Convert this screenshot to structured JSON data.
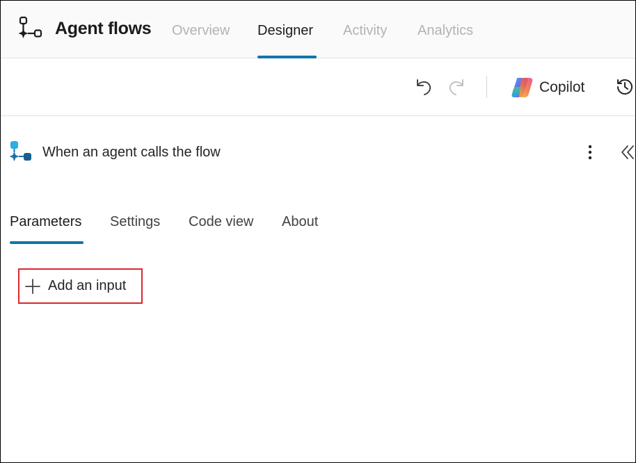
{
  "app": {
    "title": "Agent flows",
    "icon": "flow-icon"
  },
  "nav": {
    "tabs": [
      {
        "label": "Overview",
        "active": false
      },
      {
        "label": "Designer",
        "active": true
      },
      {
        "label": "Activity",
        "active": false
      },
      {
        "label": "Analytics",
        "active": false
      }
    ]
  },
  "toolbar": {
    "undo_icon": "undo-icon",
    "redo_icon": "redo-icon",
    "copilot_label": "Copilot",
    "history_icon": "history-icon"
  },
  "panel": {
    "title": "When an agent calls the flow",
    "trigger_icon": "agent-trigger-icon",
    "tabs": [
      {
        "label": "Parameters",
        "active": true
      },
      {
        "label": "Settings",
        "active": false
      },
      {
        "label": "Code view",
        "active": false
      },
      {
        "label": "About",
        "active": false
      }
    ],
    "add_input_label": "Add an input"
  },
  "colors": {
    "accent": "#1274ac",
    "highlight_border": "#d9272e",
    "inactive_nav": "#b3b3b3"
  }
}
